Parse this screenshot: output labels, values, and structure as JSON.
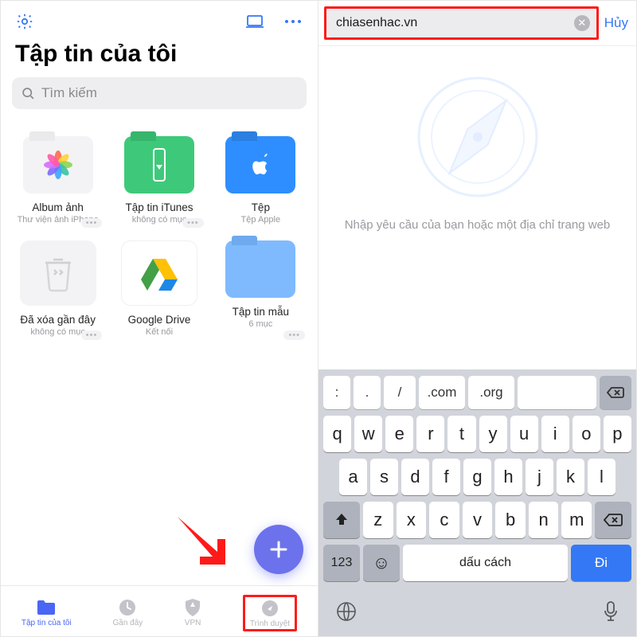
{
  "left": {
    "title": "Tập tin của tôi",
    "search_placeholder": "Tìm kiếm",
    "tiles": [
      {
        "name": "Album ảnh",
        "sub": "Thư viện ảnh iPhone"
      },
      {
        "name": "Tập tin iTunes",
        "sub": "không có mục"
      },
      {
        "name": "Tệp",
        "sub": "Tệp Apple"
      },
      {
        "name": "Đã xóa gần đây",
        "sub": "không có mục"
      },
      {
        "name": "Google Drive",
        "sub": "Kết nối"
      },
      {
        "name": "Tập tin mẫu",
        "sub": "6 mục"
      }
    ],
    "tabs": {
      "files": "Tập tin của tôi",
      "recent": "Gần đây",
      "vpn": "VPN",
      "browser": "Trình duyệt"
    }
  },
  "right": {
    "url_value": "chiasenhac.vn",
    "cancel": "Hủy",
    "prompt": "Nhập yêu cầu của bạn hoặc một địa chỉ trang web",
    "suggestions": [
      ":",
      ".",
      "/",
      ".com",
      ".org"
    ],
    "rows": [
      [
        "q",
        "w",
        "e",
        "r",
        "t",
        "y",
        "u",
        "i",
        "o",
        "p"
      ],
      [
        "a",
        "s",
        "d",
        "f",
        "g",
        "h",
        "j",
        "k",
        "l"
      ],
      [
        "z",
        "x",
        "c",
        "v",
        "b",
        "n",
        "m"
      ]
    ],
    "numkey": "123",
    "space": "dấu cách",
    "go": "Đi"
  }
}
